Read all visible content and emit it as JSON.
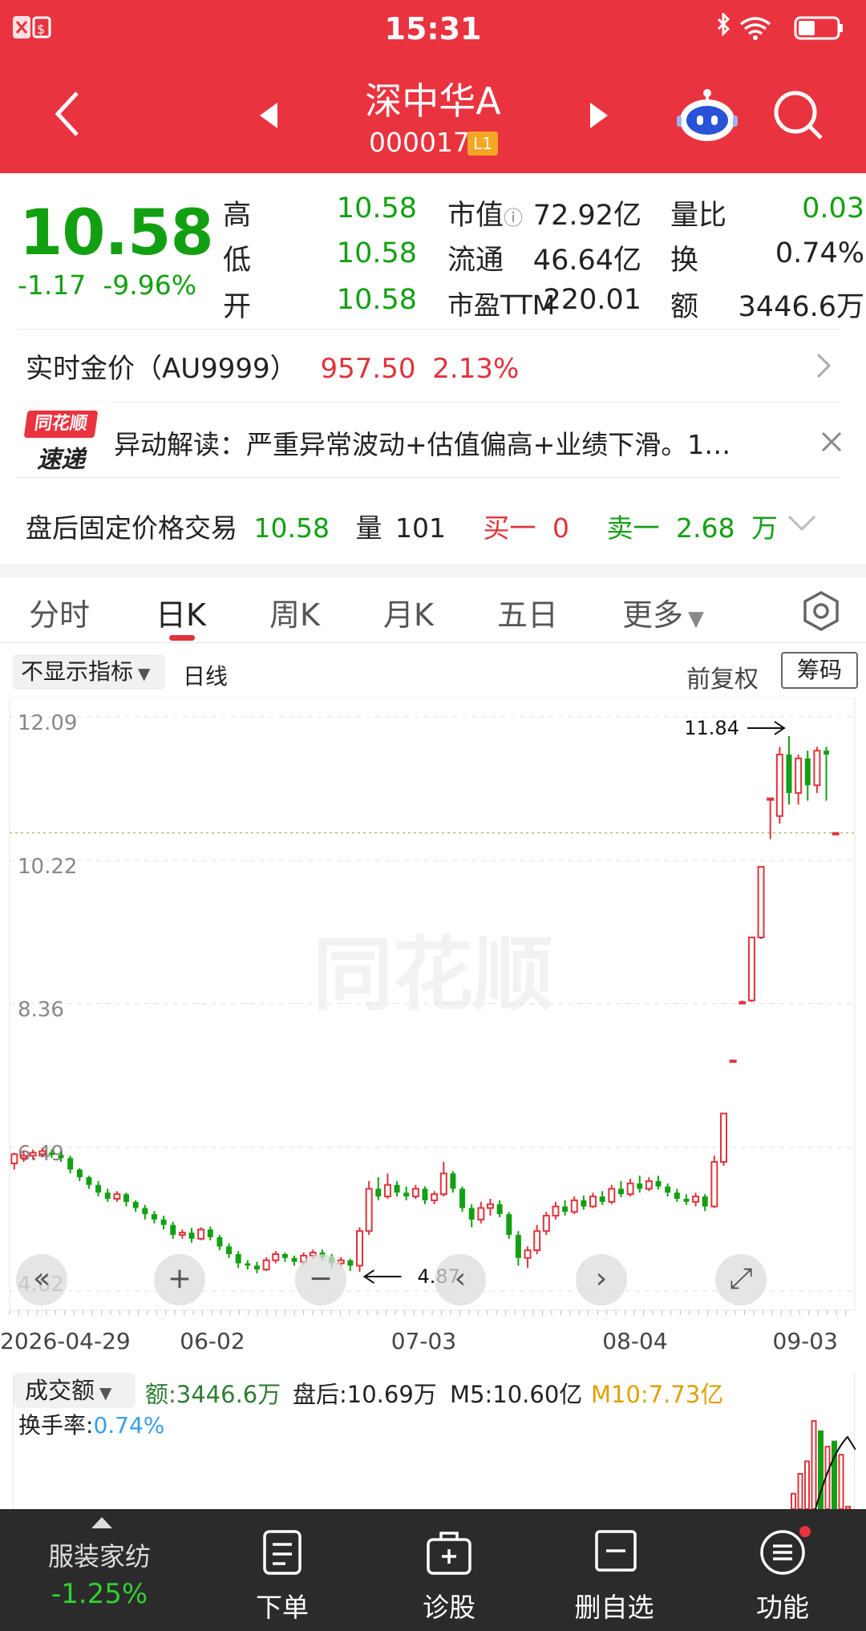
{
  "status": {
    "time": "15:31"
  },
  "header": {
    "title": "深中华A",
    "code": "000017",
    "level": "L1"
  },
  "quote": {
    "price": "10.58",
    "change": "-1.17",
    "change_pct": "-9.96%",
    "high_label": "高",
    "high": "10.58",
    "low_label": "低",
    "low": "10.58",
    "open_label": "开",
    "open": "10.58",
    "mcap_label": "市值",
    "mcap": "72.92亿",
    "float_label": "流通",
    "float": "46.64亿",
    "pe_label": "市盈TTM",
    "pe": "220.01",
    "vr_label": "量比",
    "vr": "0.03",
    "turnover_label": "换",
    "turnover": "0.74%",
    "amount_label": "额",
    "amount": "3446.6万"
  },
  "gold": {
    "label": "实时金价（AU9999）",
    "price": "957.50",
    "pct": "2.13%"
  },
  "news": {
    "badge_top": "同花顺",
    "badge_bottom": "速递",
    "text": "异动解读：严重异常波动+估值偏高+业绩下滑。1…"
  },
  "after_hours": {
    "label": "盘后固定价格交易",
    "price": "10.58",
    "vol_label": "量",
    "vol": "101",
    "buy_label": "买一",
    "buy": "0",
    "sell_label": "卖一",
    "sell": "2.68",
    "sell_unit": "万"
  },
  "tabs": [
    "分时",
    "日K",
    "周K",
    "月K",
    "五日",
    "更多"
  ],
  "chart_toolbar": {
    "indicator": "不显示指标",
    "period": "日线",
    "adjust": "前复权",
    "chips": "筹码"
  },
  "chart_data": {
    "type": "candlestick",
    "y_ticks": [
      "12.09",
      "10.22",
      "8.36",
      "6.49",
      "4.62"
    ],
    "x_ticks": [
      "2026-04-29",
      "06-02",
      "07-03",
      "08-04",
      "09-03"
    ],
    "max_label": "11.84",
    "min_label": "4.87",
    "ylim": [
      4.62,
      12.09
    ],
    "last_close": 10.58,
    "candles": [
      [
        6.28,
        6.4,
        6.2,
        6.42
      ],
      [
        6.35,
        6.38,
        6.3,
        6.45
      ],
      [
        6.38,
        6.42,
        6.33,
        6.46
      ],
      [
        6.4,
        6.44,
        6.36,
        6.48
      ],
      [
        6.42,
        6.39,
        6.35,
        6.46
      ],
      [
        6.39,
        6.35,
        6.3,
        6.42
      ],
      [
        6.35,
        6.2,
        6.15,
        6.38
      ],
      [
        6.2,
        6.1,
        6.05,
        6.22
      ],
      [
        6.1,
        6.0,
        5.95,
        6.12
      ],
      [
        6.0,
        5.9,
        5.85,
        6.05
      ],
      [
        5.9,
        5.82,
        5.78,
        5.95
      ],
      [
        5.82,
        5.88,
        5.78,
        5.92
      ],
      [
        5.88,
        5.78,
        5.72,
        5.9
      ],
      [
        5.78,
        5.7,
        5.65,
        5.8
      ],
      [
        5.7,
        5.62,
        5.55,
        5.74
      ],
      [
        5.62,
        5.55,
        5.5,
        5.66
      ],
      [
        5.55,
        5.48,
        5.42,
        5.6
      ],
      [
        5.48,
        5.35,
        5.3,
        5.52
      ],
      [
        5.35,
        5.38,
        5.3,
        5.42
      ],
      [
        5.38,
        5.3,
        5.25,
        5.44
      ],
      [
        5.3,
        5.42,
        5.28,
        5.45
      ],
      [
        5.42,
        5.32,
        5.28,
        5.46
      ],
      [
        5.32,
        5.2,
        5.15,
        5.35
      ],
      [
        5.2,
        5.1,
        5.05,
        5.24
      ],
      [
        5.1,
        4.98,
        4.92,
        5.14
      ],
      [
        4.98,
        4.95,
        4.9,
        5.02
      ],
      [
        4.95,
        4.9,
        4.85,
        5.0
      ],
      [
        4.9,
        5.02,
        4.88,
        5.06
      ],
      [
        5.02,
        5.1,
        4.98,
        5.14
      ],
      [
        5.1,
        5.05,
        5.0,
        5.12
      ],
      [
        5.05,
        5.0,
        4.95,
        5.08
      ],
      [
        5.0,
        5.08,
        4.96,
        5.12
      ],
      [
        5.08,
        5.12,
        5.04,
        5.16
      ],
      [
        5.12,
        5.06,
        5.02,
        5.16
      ],
      [
        5.06,
        4.98,
        4.92,
        5.1
      ],
      [
        4.98,
        5.02,
        4.94,
        5.06
      ],
      [
        5.02,
        4.95,
        4.88,
        5.04
      ],
      [
        4.95,
        5.4,
        4.87,
        5.45
      ],
      [
        5.4,
        5.95,
        5.35,
        6.05
      ],
      [
        5.95,
        5.85,
        5.8,
        6.1
      ],
      [
        5.85,
        6.0,
        5.82,
        6.15
      ],
      [
        6.0,
        5.9,
        5.85,
        6.05
      ],
      [
        5.9,
        5.85,
        5.8,
        5.98
      ],
      [
        5.85,
        5.95,
        5.82,
        6.0
      ],
      [
        5.95,
        5.8,
        5.75,
        5.98
      ],
      [
        5.8,
        5.88,
        5.75,
        5.92
      ],
      [
        5.88,
        6.15,
        5.85,
        6.3
      ],
      [
        6.15,
        5.95,
        5.9,
        6.18
      ],
      [
        5.95,
        5.7,
        5.65,
        5.98
      ],
      [
        5.7,
        5.55,
        5.45,
        5.75
      ],
      [
        5.55,
        5.7,
        5.5,
        5.78
      ],
      [
        5.7,
        5.75,
        5.6,
        5.82
      ],
      [
        5.75,
        5.62,
        5.58,
        5.8
      ],
      [
        5.62,
        5.35,
        5.3,
        5.65
      ],
      [
        5.35,
        5.05,
        4.95,
        5.4
      ],
      [
        5.05,
        5.15,
        4.92,
        5.2
      ],
      [
        5.15,
        5.4,
        5.1,
        5.48
      ],
      [
        5.4,
        5.6,
        5.35,
        5.65
      ],
      [
        5.6,
        5.72,
        5.55,
        5.78
      ],
      [
        5.72,
        5.65,
        5.6,
        5.8
      ],
      [
        5.65,
        5.8,
        5.62,
        5.85
      ],
      [
        5.8,
        5.72,
        5.68,
        5.86
      ],
      [
        5.72,
        5.85,
        5.7,
        5.9
      ],
      [
        5.85,
        5.78,
        5.74,
        5.92
      ],
      [
        5.78,
        5.95,
        5.75,
        6.0
      ],
      [
        5.95,
        5.88,
        5.84,
        6.05
      ],
      [
        5.88,
        6.02,
        5.85,
        6.08
      ],
      [
        6.02,
        5.95,
        5.9,
        6.12
      ],
      [
        5.95,
        6.05,
        5.92,
        6.1
      ],
      [
        6.05,
        5.98,
        5.94,
        6.12
      ],
      [
        5.98,
        5.9,
        5.85,
        6.02
      ],
      [
        5.9,
        5.82,
        5.78,
        5.95
      ],
      [
        5.82,
        5.78,
        5.74,
        5.88
      ],
      [
        5.78,
        5.85,
        5.72,
        5.9
      ],
      [
        5.85,
        5.72,
        5.66,
        5.88
      ],
      [
        5.72,
        6.3,
        5.7,
        6.38
      ],
      [
        6.3,
        6.93,
        6.25,
        6.93
      ],
      [
        7.62,
        7.62,
        7.62,
        7.62
      ],
      [
        8.38,
        8.38,
        8.36,
        8.4
      ],
      [
        8.4,
        9.22,
        8.38,
        9.22
      ],
      [
        9.22,
        10.14,
        9.2,
        10.14
      ],
      [
        11.03,
        11.03,
        10.5,
        11.03
      ],
      [
        10.8,
        11.6,
        10.7,
        11.7
      ],
      [
        11.6,
        11.1,
        10.95,
        11.84
      ],
      [
        11.1,
        11.55,
        10.95,
        11.6
      ],
      [
        11.55,
        11.2,
        11.0,
        11.65
      ],
      [
        11.2,
        11.65,
        11.1,
        11.7
      ],
      [
        11.65,
        11.6,
        11.0,
        11.7
      ],
      [
        10.58,
        10.58,
        10.58,
        10.58
      ]
    ]
  },
  "volume": {
    "selector": "成交额",
    "amount_label": "额:3446.6万",
    "after_label": "盘后:10.69万",
    "m5": "M5:10.60亿",
    "m10": "M10:7.73亿",
    "turnover_label": "换手率:",
    "turnover": "0.74%",
    "values": [
      2.1,
      4.8,
      6.5,
      12.0,
      10.6,
      8.5,
      9.2,
      7.4,
      0.34
    ]
  },
  "bottom_bar": {
    "sector": "服装家纺",
    "sector_pct": "-1.25%",
    "items": [
      "下单",
      "诊股",
      "删自选",
      "功能"
    ]
  },
  "colors": {
    "header": "#e9333f",
    "up": "#e0333c",
    "down": "#12a012",
    "bottom_bar": "#2b2b2b"
  }
}
